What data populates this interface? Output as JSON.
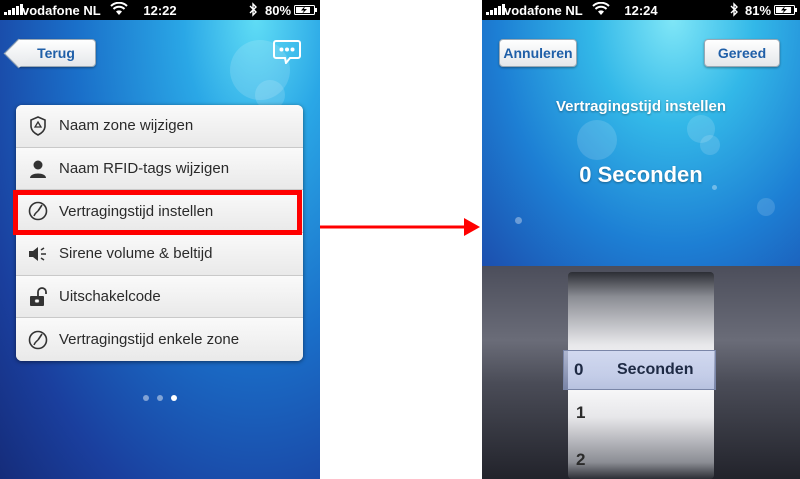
{
  "left_screen": {
    "status": {
      "carrier": "vodafone NL",
      "time": "12:22",
      "battery": "80%"
    },
    "back_label": "Terug",
    "menu": [
      {
        "label": "Naam zone wijzigen",
        "icon": "shield-icon"
      },
      {
        "label": "Naam RFID-tags wijzigen",
        "icon": "person-icon"
      },
      {
        "label": "Vertragingstijd instellen",
        "icon": "stopwatch-icon"
      },
      {
        "label": "Sirene volume & beltijd",
        "icon": "speaker-icon"
      },
      {
        "label": "Uitschakelcode",
        "icon": "padlock-icon"
      },
      {
        "label": "Vertragingstijd enkele zone",
        "icon": "stopwatch-icon"
      }
    ],
    "highlighted_item": "Vertragingstijd instellen",
    "page_indicator": {
      "pages": 3,
      "active": 3
    }
  },
  "right_screen": {
    "status": {
      "carrier": "vodafone NL",
      "time": "12:24",
      "battery": "81%"
    },
    "cancel_label": "Annuleren",
    "done_label": "Gereed",
    "title": "Vertragingstijd instellen",
    "value": "0 Seconden",
    "picker": {
      "selected": "0",
      "unit": "Seconden",
      "options": [
        "0",
        "1",
        "2"
      ]
    }
  },
  "colors": {
    "highlight": "#ff0000",
    "arrow": "#ff0000",
    "button_text": "#1f5fa8"
  }
}
